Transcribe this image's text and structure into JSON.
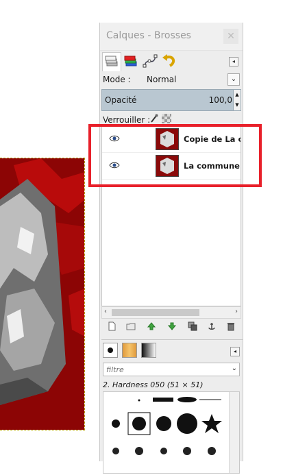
{
  "dock": {
    "title": "Calques - Brosses",
    "close_glyph": "✕",
    "tab_menu_glyph": "◂",
    "tabs": [
      {
        "name": "layers-tab",
        "icon": "layers-icon"
      },
      {
        "name": "channels-tab",
        "icon": "channels-icon"
      },
      {
        "name": "paths-tab",
        "icon": "paths-icon"
      },
      {
        "name": "undo-history-tab",
        "icon": "undo-icon"
      }
    ]
  },
  "layers": {
    "mode_label": "Mode :",
    "mode_value": "Normal",
    "mode_dropdown_glyph": "⌄",
    "opacity_label": "Opacité",
    "opacity_value": "100,0",
    "opacity_spin_up": "▲",
    "opacity_spin_down": "▼",
    "lock_label": "Verrouiller :",
    "items": [
      {
        "name": "Copie de La cor",
        "visible": true
      },
      {
        "name": "La commune.jp",
        "visible": true
      }
    ],
    "scroll_left": "‹",
    "scroll_right": "›",
    "toolbar": [
      "new-layer-icon",
      "layer-group-icon",
      "raise-layer-icon",
      "lower-layer-icon",
      "duplicate-layer-icon",
      "anchor-layer-icon",
      "delete-layer-icon"
    ]
  },
  "brushes": {
    "filter_placeholder": "filtre",
    "filter_dropdown_glyph": "⌄",
    "brush_name": "2. Hardness 050 (51 × 51)",
    "tab_menu_glyph": "◂"
  },
  "colors": {
    "highlight_box": "#e8202a",
    "opacity_bar": "#b9c7d1"
  }
}
